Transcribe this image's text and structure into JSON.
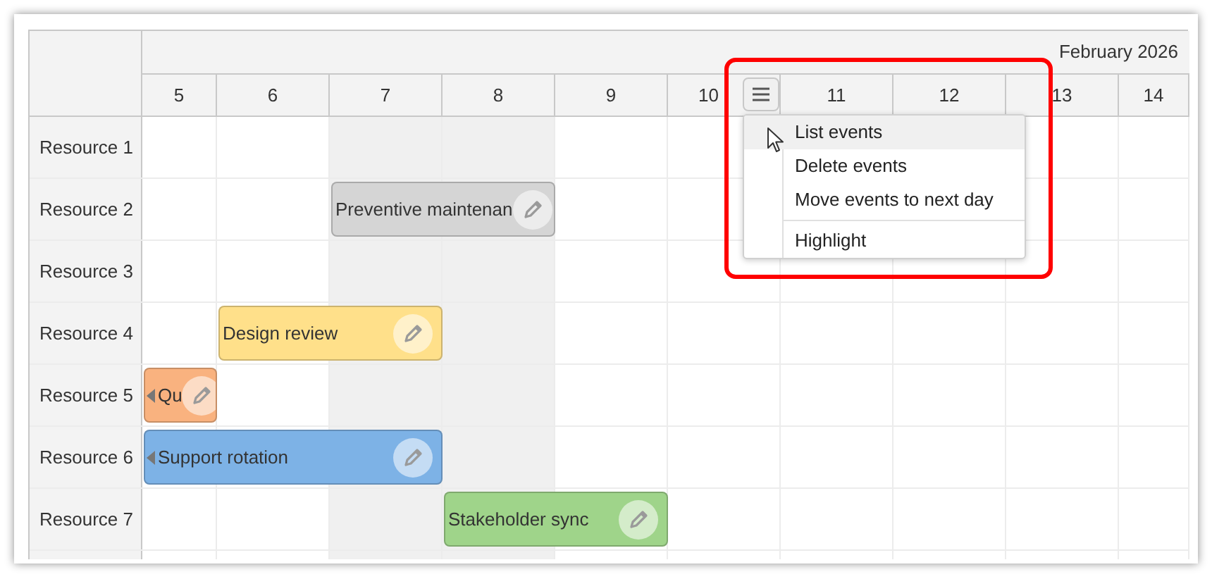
{
  "header": {
    "month": "February 2026",
    "menu_open": true
  },
  "days": [
    {
      "label": "5",
      "weekend": false
    },
    {
      "label": "6",
      "weekend": false
    },
    {
      "label": "7",
      "weekend": true
    },
    {
      "label": "8",
      "weekend": true
    },
    {
      "label": "9",
      "weekend": false
    },
    {
      "label": "10",
      "weekend": false,
      "has_menu": true
    },
    {
      "label": "11",
      "weekend": false
    },
    {
      "label": "12",
      "weekend": false
    },
    {
      "label": "13",
      "weekend": false
    },
    {
      "label": "14",
      "weekend": false
    }
  ],
  "rows": [
    {
      "name": "Resource 1",
      "cells": [
        {
          "kind": "empty"
        },
        {
          "kind": "empty"
        },
        {
          "kind": "empty"
        },
        {
          "kind": "empty"
        },
        {
          "kind": "empty"
        },
        {
          "kind": "empty"
        },
        {
          "kind": "empty"
        },
        {
          "kind": "empty"
        },
        {
          "kind": "empty"
        },
        {
          "kind": "empty"
        }
      ]
    },
    {
      "name": "Resource 2",
      "cells": [
        {
          "kind": "empty"
        },
        {
          "kind": "empty"
        },
        {
          "kind": "event",
          "text": "Preventive maintenan",
          "color": "#d5d5d5",
          "continues_left": false
        },
        {
          "kind": "continued"
        },
        {
          "kind": "empty"
        },
        {
          "kind": "empty"
        },
        {
          "kind": "empty"
        },
        {
          "kind": "empty"
        },
        {
          "kind": "empty"
        },
        {
          "kind": "empty"
        }
      ]
    },
    {
      "name": "Resource 3",
      "cells": [
        {
          "kind": "empty"
        },
        {
          "kind": "empty"
        },
        {
          "kind": "empty"
        },
        {
          "kind": "empty"
        },
        {
          "kind": "empty"
        },
        {
          "kind": "empty"
        },
        {
          "kind": "empty"
        },
        {
          "kind": "empty"
        },
        {
          "kind": "empty"
        },
        {
          "kind": "empty"
        }
      ]
    },
    {
      "name": "Resource 4",
      "cells": [
        {
          "kind": "empty"
        },
        {
          "kind": "event",
          "text": "Design review",
          "color": "#ffe08a",
          "continues_left": false
        },
        {
          "kind": "continued"
        },
        {
          "kind": "empty"
        },
        {
          "kind": "empty"
        },
        {
          "kind": "empty"
        },
        {
          "kind": "empty"
        },
        {
          "kind": "empty"
        },
        {
          "kind": "empty"
        },
        {
          "kind": "empty"
        }
      ]
    },
    {
      "name": "Resource 5",
      "cells": [
        {
          "kind": "event",
          "text": "Qu",
          "color": "#f9b27f",
          "continues_left": true
        },
        {
          "kind": "empty"
        },
        {
          "kind": "empty"
        },
        {
          "kind": "empty"
        },
        {
          "kind": "empty"
        },
        {
          "kind": "empty"
        },
        {
          "kind": "empty"
        },
        {
          "kind": "empty"
        },
        {
          "kind": "empty"
        },
        {
          "kind": "empty"
        }
      ]
    },
    {
      "name": "Resource 6",
      "cells": [
        {
          "kind": "event",
          "text": "Support rotation",
          "color": "#7db2e6",
          "continues_left": true
        },
        {
          "kind": "continued"
        },
        {
          "kind": "continued"
        },
        {
          "kind": "empty"
        },
        {
          "kind": "empty"
        },
        {
          "kind": "empty"
        },
        {
          "kind": "empty"
        },
        {
          "kind": "empty"
        },
        {
          "kind": "empty"
        },
        {
          "kind": "empty"
        }
      ]
    },
    {
      "name": "Resource 7",
      "cells": [
        {
          "kind": "empty"
        },
        {
          "kind": "empty"
        },
        {
          "kind": "empty"
        },
        {
          "kind": "event",
          "text": "Stakeholder sync",
          "color": "#9fd48a",
          "continues_left": false
        },
        {
          "kind": "continued"
        },
        {
          "kind": "empty"
        },
        {
          "kind": "empty"
        },
        {
          "kind": "empty"
        },
        {
          "kind": "empty"
        },
        {
          "kind": "empty"
        }
      ]
    }
  ],
  "context_menu": {
    "items": [
      {
        "kind": "item",
        "label": "List events",
        "selected": true
      },
      {
        "kind": "item",
        "label": "Delete events",
        "selected": false
      },
      {
        "kind": "item",
        "label": "Move events to next day",
        "selected": false
      },
      {
        "kind": "separator"
      },
      {
        "kind": "item",
        "label": "Highlight",
        "selected": false
      }
    ]
  }
}
